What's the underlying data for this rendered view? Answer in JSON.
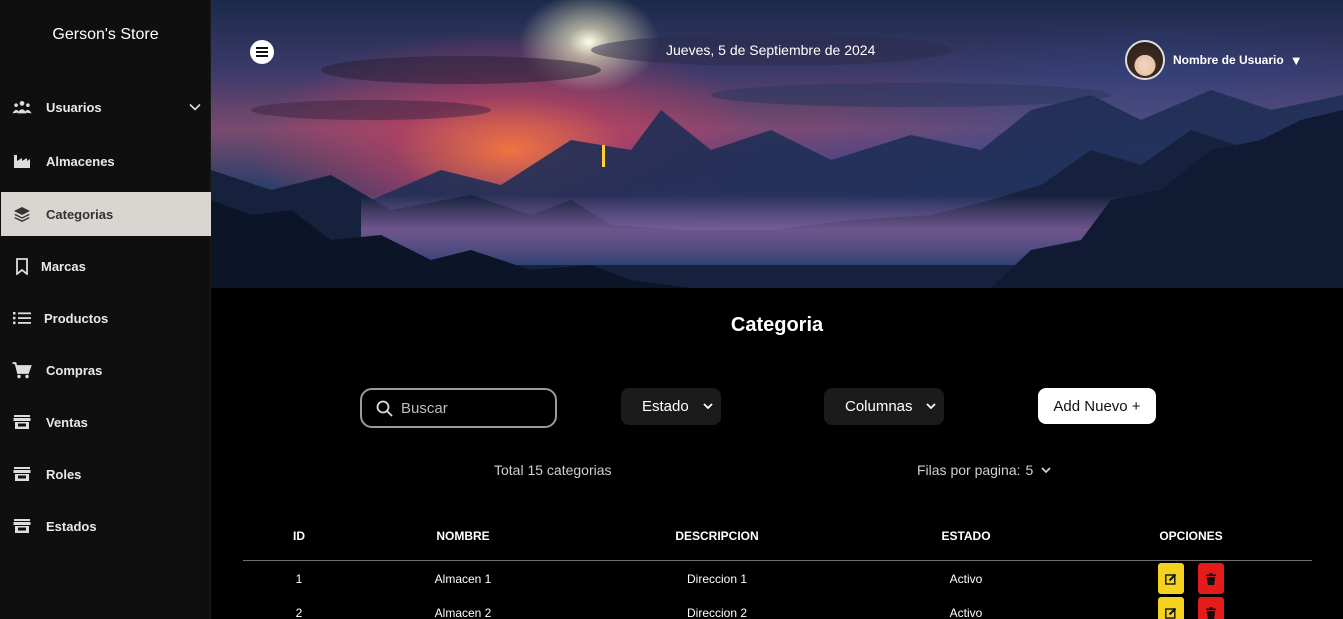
{
  "sidebar": {
    "brand": "Gerson's Store",
    "items": [
      {
        "label": "Usuarios",
        "icon": "users-group-icon",
        "expandable": true
      },
      {
        "label": "Almacenes",
        "icon": "factory-icon"
      },
      {
        "label": "Categorias",
        "icon": "layers-icon",
        "active": true
      },
      {
        "label": "Marcas",
        "icon": "bookmark-icon"
      },
      {
        "label": "Productos",
        "icon": "list-icon"
      },
      {
        "label": "Compras",
        "icon": "cart-icon"
      },
      {
        "label": "Ventas",
        "icon": "store-icon"
      },
      {
        "label": "Roles",
        "icon": "store-icon"
      },
      {
        "label": "Estados",
        "icon": "store-icon"
      }
    ]
  },
  "header": {
    "date": "Jueves, 5 de Septiembre de 2024",
    "user_name": "Nombre de Usuario",
    "user_caret": "▼"
  },
  "main": {
    "title": "Categoria",
    "search_placeholder": "Buscar",
    "estado_select": "Estado",
    "columnas_select": "Columnas",
    "add_button": "Add Nuevo +",
    "total_text": "Total 15 categorias",
    "rows_per_page_label": "Filas por pagina:",
    "rows_per_page_value": "5"
  },
  "table": {
    "headers": [
      "ID",
      "NOMBRE",
      "DESCRIPCION",
      "ESTADO",
      "OPCIONES"
    ],
    "rows": [
      {
        "id": "1",
        "nombre": "Almacen 1",
        "descripcion": "Direccion 1",
        "estado": "Activo"
      },
      {
        "id": "2",
        "nombre": "Almacen 2",
        "descripcion": "Direccion 2",
        "estado": "Activo"
      }
    ]
  },
  "colors": {
    "sidebar_bg": "#0f0f10",
    "active_item_bg": "#d9d6d2",
    "edit_button": "#f4d21f",
    "delete_button": "#e31b1b",
    "select_bg": "#1b1b1c"
  }
}
